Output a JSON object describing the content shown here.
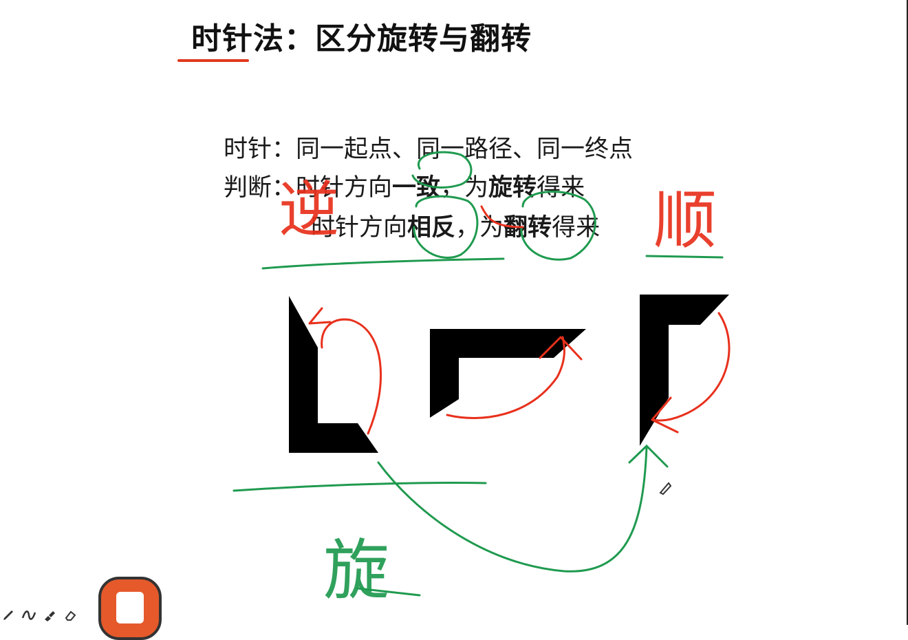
{
  "slide": {
    "title": "时针法：区分旋转与翻转",
    "line1": "时针：同一起点、同一路径、同一终点",
    "line2": {
      "prefix": "判断：时针方向",
      "bold_same": "一致",
      "middle": "，为",
      "bold_rotate": "旋转",
      "suffix": "得来"
    },
    "line3": {
      "prefix": "时针方向",
      "bold_opposite": "相反",
      "middle": "，为",
      "bold_flip": "翻转",
      "suffix": "得来"
    }
  },
  "annotations": {
    "counterclockwise": "逆",
    "clockwise": "顺",
    "rotate": "旋"
  },
  "colors": {
    "accent_red": "#e03a1e",
    "ink_red": "#e8301c",
    "ink_green": "#1f9a4f",
    "shape_black": "#000000"
  },
  "toolbar": {
    "tools": [
      "pen-icon",
      "curve-icon",
      "highlighter-icon",
      "eraser-icon"
    ],
    "note_button": "note-icon"
  }
}
